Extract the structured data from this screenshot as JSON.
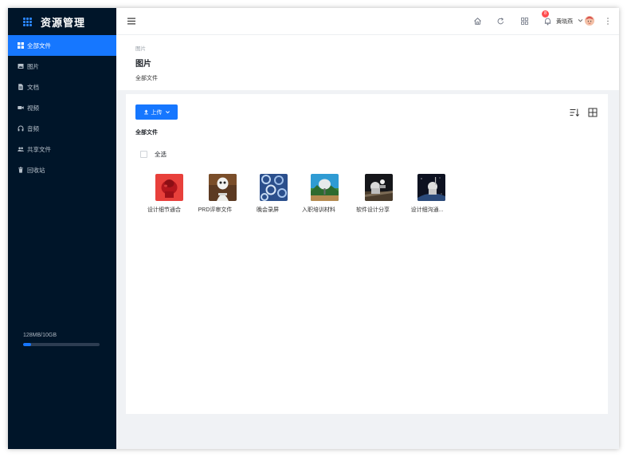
{
  "app": {
    "title": "资源管理"
  },
  "sidebar": {
    "items": [
      {
        "label": "全部文件",
        "icon": "grid-icon",
        "active": true
      },
      {
        "label": "图片",
        "icon": "image-icon",
        "active": false
      },
      {
        "label": "文档",
        "icon": "document-icon",
        "active": false
      },
      {
        "label": "视频",
        "icon": "video-icon",
        "active": false
      },
      {
        "label": "音频",
        "icon": "headphones-icon",
        "active": false
      },
      {
        "label": "共享文件",
        "icon": "users-icon",
        "active": false
      },
      {
        "label": "回收站",
        "icon": "trash-icon",
        "active": false
      }
    ],
    "storage": {
      "text": "128MB/10GB",
      "used_fraction": 0.1
    }
  },
  "header": {
    "notification_count": "8",
    "username": "黄晓燕",
    "icons": [
      "home-icon",
      "refresh-icon",
      "apps-icon",
      "bell-icon",
      "more-vertical-icon"
    ]
  },
  "page": {
    "breadcrumb": "图片",
    "title": "图片",
    "subtitle": "全部文件"
  },
  "toolbar": {
    "upload_label": "上传",
    "section_title": "全部文件",
    "select_all_label": "全选"
  },
  "files": [
    {
      "name": "设计细节通合"
    },
    {
      "name": "PRD评审文件"
    },
    {
      "name": "晚会录屏"
    },
    {
      "name": "入职培训材料"
    },
    {
      "name": "软件设计分享"
    },
    {
      "name": "设计细沟通..."
    }
  ],
  "colors": {
    "accent": "#1677ff",
    "sidebar_bg": "#001529",
    "badge": "#ff4d4f"
  }
}
